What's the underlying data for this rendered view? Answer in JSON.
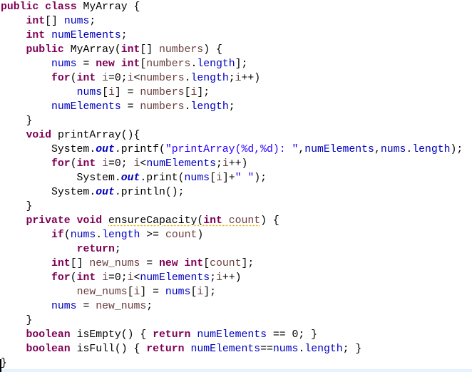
{
  "editor": {
    "language": "java",
    "colors": {
      "keyword": "#7f0055",
      "field": "#0000c0",
      "local": "#6a3e3e",
      "string": "#2a00ff"
    },
    "lines": [
      [
        [
          "k",
          "public"
        ],
        [
          "p",
          " "
        ],
        [
          "k",
          "class"
        ],
        [
          "p",
          " MyArray {"
        ]
      ],
      [
        [
          "p",
          "    "
        ],
        [
          "k",
          "int"
        ],
        [
          "p",
          "[] "
        ],
        [
          "f",
          "nums"
        ],
        [
          "p",
          ";"
        ]
      ],
      [
        [
          "p",
          "    "
        ],
        [
          "k",
          "int"
        ],
        [
          "p",
          " "
        ],
        [
          "f",
          "numElements"
        ],
        [
          "p",
          ";"
        ]
      ],
      [
        [
          "p",
          "    "
        ],
        [
          "k",
          "public"
        ],
        [
          "p",
          " MyArray("
        ],
        [
          "k",
          "int"
        ],
        [
          "p",
          "[] "
        ],
        [
          "l",
          "numbers"
        ],
        [
          "p",
          ") {"
        ]
      ],
      [
        [
          "p",
          "        "
        ],
        [
          "f",
          "nums"
        ],
        [
          "p",
          " = "
        ],
        [
          "k",
          "new"
        ],
        [
          "p",
          " "
        ],
        [
          "k",
          "int"
        ],
        [
          "p",
          "["
        ],
        [
          "l",
          "numbers"
        ],
        [
          "p",
          "."
        ],
        [
          "f",
          "length"
        ],
        [
          "p",
          "];"
        ]
      ],
      [
        [
          "p",
          "        "
        ],
        [
          "k",
          "for"
        ],
        [
          "p",
          "("
        ],
        [
          "k",
          "int"
        ],
        [
          "p",
          " "
        ],
        [
          "l",
          "i"
        ],
        [
          "p",
          "=0;"
        ],
        [
          "l",
          "i"
        ],
        [
          "p",
          "<"
        ],
        [
          "l",
          "numbers"
        ],
        [
          "p",
          "."
        ],
        [
          "f",
          "length"
        ],
        [
          "p",
          ";"
        ],
        [
          "l",
          "i"
        ],
        [
          "p",
          "++)"
        ]
      ],
      [
        [
          "p",
          "            "
        ],
        [
          "f",
          "nums"
        ],
        [
          "p",
          "["
        ],
        [
          "l",
          "i"
        ],
        [
          "p",
          "] = "
        ],
        [
          "l",
          "numbers"
        ],
        [
          "p",
          "["
        ],
        [
          "l",
          "i"
        ],
        [
          "p",
          "];"
        ]
      ],
      [
        [
          "p",
          "        "
        ],
        [
          "f",
          "numElements"
        ],
        [
          "p",
          " = "
        ],
        [
          "l",
          "numbers"
        ],
        [
          "p",
          "."
        ],
        [
          "f",
          "length"
        ],
        [
          "p",
          ";"
        ]
      ],
      [
        [
          "p",
          "    }"
        ]
      ],
      [
        [
          "p",
          "    "
        ],
        [
          "k",
          "void"
        ],
        [
          "p",
          " printArray(){"
        ]
      ],
      [
        [
          "p",
          "        System."
        ],
        [
          "so",
          "out"
        ],
        [
          "p",
          ".printf("
        ],
        [
          "s",
          "\"printArray(%d,%d): \""
        ],
        [
          "p",
          ","
        ],
        [
          "f",
          "numElements"
        ],
        [
          "p",
          ","
        ],
        [
          "f",
          "nums"
        ],
        [
          "p",
          "."
        ],
        [
          "f",
          "length"
        ],
        [
          "p",
          ");"
        ]
      ],
      [
        [
          "p",
          "        "
        ],
        [
          "k",
          "for"
        ],
        [
          "p",
          "("
        ],
        [
          "k",
          "int"
        ],
        [
          "p",
          " "
        ],
        [
          "l",
          "i"
        ],
        [
          "p",
          "=0; "
        ],
        [
          "l",
          "i"
        ],
        [
          "p",
          "<"
        ],
        [
          "f",
          "numElements"
        ],
        [
          "p",
          ";"
        ],
        [
          "l",
          "i"
        ],
        [
          "p",
          "++)"
        ]
      ],
      [
        [
          "p",
          "            System."
        ],
        [
          "so",
          "out"
        ],
        [
          "p",
          ".print("
        ],
        [
          "f",
          "nums"
        ],
        [
          "p",
          "["
        ],
        [
          "l",
          "i"
        ],
        [
          "p",
          "]+"
        ],
        [
          "s",
          "\" \""
        ],
        [
          "p",
          ");"
        ]
      ],
      [
        [
          "p",
          "        System."
        ],
        [
          "so",
          "out"
        ],
        [
          "p",
          ".println();"
        ]
      ],
      [
        [
          "p",
          "    }"
        ]
      ],
      [
        [
          "p",
          "    "
        ],
        [
          "k",
          "private"
        ],
        [
          "p",
          " "
        ],
        [
          "k",
          "void"
        ],
        [
          "p",
          " "
        ],
        [
          "w",
          "ensureCapacity("
        ],
        [
          "k w",
          "int"
        ],
        [
          "l w",
          " count"
        ],
        [
          "p",
          ") {"
        ]
      ],
      [
        [
          "p",
          "        "
        ],
        [
          "k",
          "if"
        ],
        [
          "p",
          "("
        ],
        [
          "f",
          "nums"
        ],
        [
          "p",
          "."
        ],
        [
          "f",
          "length"
        ],
        [
          "p",
          " >= "
        ],
        [
          "l",
          "count"
        ],
        [
          "p",
          ")"
        ]
      ],
      [
        [
          "p",
          "            "
        ],
        [
          "k",
          "return"
        ],
        [
          "p",
          ";"
        ]
      ],
      [
        [
          "p",
          "        "
        ],
        [
          "k",
          "int"
        ],
        [
          "p",
          "[] "
        ],
        [
          "l",
          "new_nums"
        ],
        [
          "p",
          " = "
        ],
        [
          "k",
          "new"
        ],
        [
          "p",
          " "
        ],
        [
          "k",
          "int"
        ],
        [
          "p",
          "["
        ],
        [
          "l",
          "count"
        ],
        [
          "p",
          "];"
        ]
      ],
      [
        [
          "p",
          "        "
        ],
        [
          "k",
          "for"
        ],
        [
          "p",
          "("
        ],
        [
          "k",
          "int"
        ],
        [
          "p",
          " "
        ],
        [
          "l",
          "i"
        ],
        [
          "p",
          "=0;"
        ],
        [
          "l",
          "i"
        ],
        [
          "p",
          "<"
        ],
        [
          "f",
          "numElements"
        ],
        [
          "p",
          ";"
        ],
        [
          "l",
          "i"
        ],
        [
          "p",
          "++)"
        ]
      ],
      [
        [
          "p",
          "            "
        ],
        [
          "l",
          "new_nums"
        ],
        [
          "p",
          "["
        ],
        [
          "l",
          "i"
        ],
        [
          "p",
          "] = "
        ],
        [
          "f",
          "nums"
        ],
        [
          "p",
          "["
        ],
        [
          "l",
          "i"
        ],
        [
          "p",
          "];"
        ]
      ],
      [
        [
          "p",
          "        "
        ],
        [
          "f",
          "nums"
        ],
        [
          "p",
          " = "
        ],
        [
          "l",
          "new_nums"
        ],
        [
          "p",
          ";"
        ]
      ],
      [
        [
          "p",
          "    }"
        ]
      ],
      [
        [
          "p",
          "    "
        ],
        [
          "k",
          "boolean"
        ],
        [
          "p",
          " isEmpty() { "
        ],
        [
          "k",
          "return"
        ],
        [
          "p",
          " "
        ],
        [
          "f",
          "numElements"
        ],
        [
          "p",
          " == 0; }"
        ]
      ],
      [
        [
          "p",
          "    "
        ],
        [
          "k",
          "boolean"
        ],
        [
          "p",
          " isFull() { "
        ],
        [
          "k",
          "return"
        ],
        [
          "p",
          " "
        ],
        [
          "f",
          "numElements"
        ],
        [
          "p",
          "=="
        ],
        [
          "f",
          "nums"
        ],
        [
          "p",
          "."
        ],
        [
          "f",
          "length"
        ],
        [
          "p",
          "; }"
        ]
      ],
      [
        [
          "p",
          "}"
        ]
      ]
    ]
  }
}
